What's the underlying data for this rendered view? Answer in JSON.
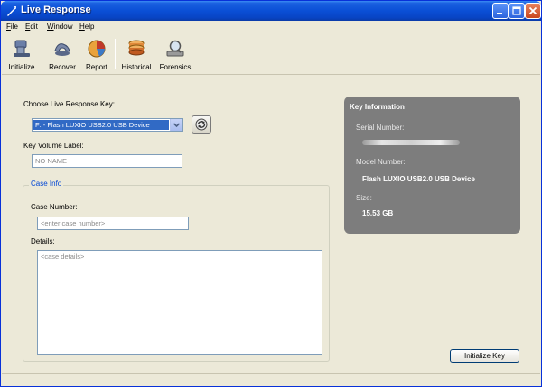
{
  "window": {
    "title": "Live Response"
  },
  "menu": [
    {
      "pre": "",
      "u": "F",
      "post": "ile"
    },
    {
      "pre": "",
      "u": "E",
      "post": "dit"
    },
    {
      "pre": "",
      "u": "W",
      "post": "indow"
    },
    {
      "pre": "",
      "u": "H",
      "post": "elp"
    }
  ],
  "toolbar": {
    "items": [
      {
        "label": "Initialize",
        "icon": "usb-key-icon"
      },
      {
        "label": "Recover",
        "icon": "recover-icon"
      },
      {
        "label": "Report",
        "icon": "report-pie-icon"
      },
      {
        "label": "Historical",
        "icon": "database-stack-icon"
      },
      {
        "label": "Forensics",
        "icon": "forensics-magnifier-icon"
      }
    ]
  },
  "form": {
    "choose_key_label": "Choose Live Response Key:",
    "selected_key": "F: - Flash LUXIO USB2.0 USB Device",
    "volume_label_label": "Key Volume Label:",
    "volume_label_value": "NO NAME",
    "case_group_title": "Case Info",
    "case_number_label": "Case Number:",
    "case_number_placeholder": "<enter case number>",
    "details_label": "Details:",
    "details_placeholder": "<case details>"
  },
  "key_info": {
    "title": "Key Information",
    "serial_label": "Serial Number:",
    "model_label": "Model Number:",
    "model_value": "Flash LUXIO USB2.0 USB Device",
    "size_label": "Size:",
    "size_value": "15.53 GB"
  },
  "actions": {
    "initialize_key": "Initialize Key"
  },
  "colors": {
    "title_bar": "#0a4fd6",
    "group_title": "#0046d5",
    "info_panel": "#7d7d7d",
    "selection": "#316ac5"
  }
}
